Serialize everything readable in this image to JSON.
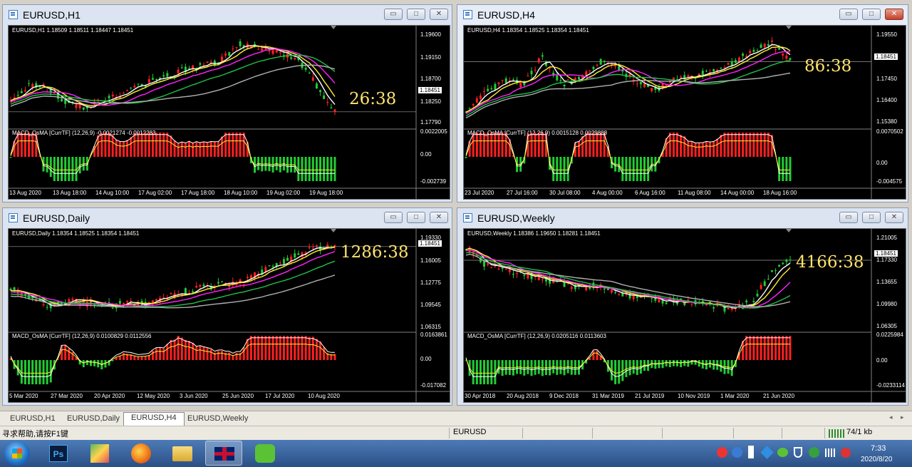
{
  "windows": {
    "h1": {
      "title": "EURUSD,H1",
      "header": "EURUSD,H1  1.18509 1.18511 1.18447 1.18451",
      "macd": "MACD_OsMA [CurrTF] (12,26,9) -0.0021274 -0.0012283",
      "timer": "26:38",
      "price": "1.18451",
      "yticks": [
        "1.19600",
        "1.19150",
        "1.18700",
        "1.18250",
        "1.17790"
      ],
      "macd_ticks": [
        "0.0022005",
        "0.00",
        "-0.002739"
      ],
      "xticks": [
        "13 Aug 2020",
        "13 Aug 18:00",
        "14 Aug 10:00",
        "17 Aug 02:00",
        "17 Aug 18:00",
        "18 Aug 10:00",
        "19 Aug 02:00",
        "19 Aug 18:00"
      ]
    },
    "h4": {
      "title": "EURUSD,H4",
      "header": "EURUSD,H4  1.18354 1.18525 1.18354 1.18451",
      "macd": "MACD_OsMA [CurrTF] (12,26,9) 0.0015128 0.0029888",
      "timer": "86:38",
      "price": "1.18451",
      "yticks": [
        "1.19550",
        "1.17450",
        "1.16400",
        "1.15380"
      ],
      "macd_ticks": [
        "0.0070502",
        "0.00",
        "-0.004575"
      ],
      "xticks": [
        "23 Jul 2020",
        "27 Jul 16:00",
        "30 Jul 08:00",
        "4 Aug 00:00",
        "6 Aug 16:00",
        "11 Aug 08:00",
        "14 Aug 00:00",
        "18 Aug 16:00"
      ]
    },
    "daily": {
      "title": "EURUSD,Daily",
      "header": "EURUSD,Daily  1.18354 1.18525 1.18354 1.18451",
      "macd": "MACD_OsMA [CurrTF] (12,26,9) 0.0100829 0.0112556",
      "timer": "1286:38",
      "price": "1.18451",
      "yticks": [
        "1.19330",
        "1.16005",
        "1.12775",
        "1.09545",
        "1.06315"
      ],
      "macd_ticks": [
        "0.0163861",
        "0.00",
        "-0.017082"
      ],
      "xticks": [
        "5 Mar 2020",
        "27 Mar 2020",
        "20 Apr 2020",
        "12 May 2020",
        "3 Jun 2020",
        "25 Jun 2020",
        "17 Jul 2020",
        "10 Aug 2020"
      ]
    },
    "weekly": {
      "title": "EURUSD,Weekly",
      "header": "EURUSD,Weekly  1.18386 1.19650 1.18281 1.18451",
      "macd": "MACD_OsMA [CurrTF] (12,26,9) 0.0205116 0.0113603",
      "timer": "4166:38",
      "price": "1.18451",
      "yticks": [
        "1.21005",
        "1.17330",
        "1.13655",
        "1.09980",
        "1.06305"
      ],
      "macd_ticks": [
        "0.0225984",
        "0.00",
        "-0.0233114"
      ],
      "xticks": [
        "30 Apr 2018",
        "20 Aug 2018",
        "9 Dec 2018",
        "31 Mar 2019",
        "21 Jul 2019",
        "10 Nov 2019",
        "1 Mar 2020",
        "21 Jun 2020"
      ]
    }
  },
  "window_buttons": {
    "minimize": "▭",
    "maximize": "□",
    "close": "✕"
  },
  "tabs": [
    "EURUSD,H1",
    "EURUSD,Daily",
    "EURUSD,H4",
    "EURUSD,Weekly"
  ],
  "active_tab": "EURUSD,H4",
  "status": {
    "help": "寻求帮助,请按F1键",
    "symbol": "EURUSD",
    "traffic": "74/1 kb"
  },
  "taskbar": {
    "time": "7:33",
    "date": "2020/8/20",
    "ps_label": "Ps"
  },
  "colors": {
    "ma_white": "#ffffff",
    "ma_yellow": "#ffee33",
    "ma_magenta": "#ff22ff",
    "ma_green": "#22c04a",
    "ma_gray": "#b0b0b0",
    "bull": "#ff2020",
    "bear": "#22cc33"
  }
}
